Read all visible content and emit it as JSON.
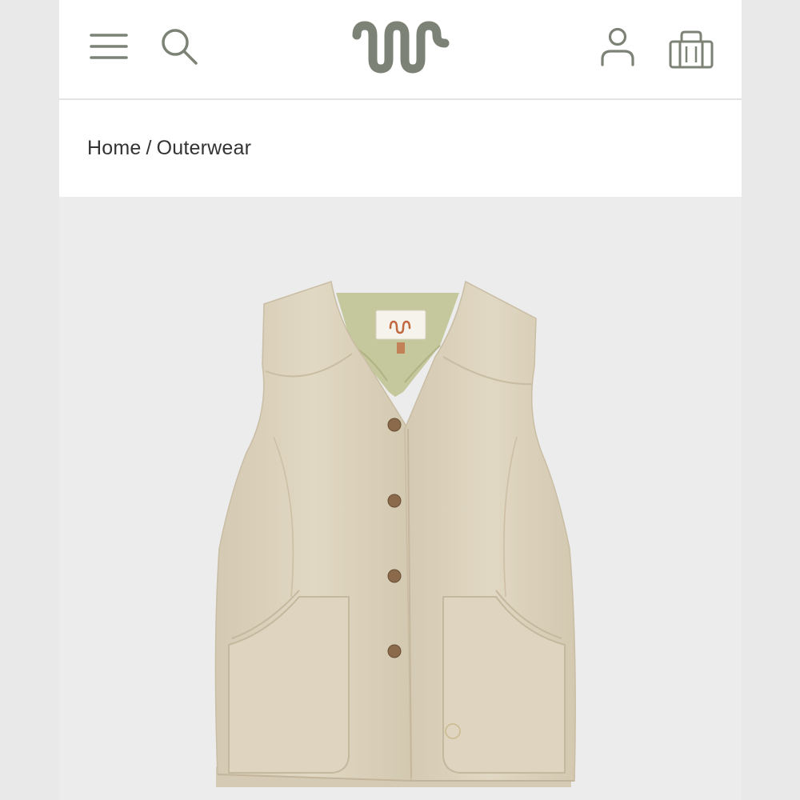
{
  "header": {
    "menu_icon": "hamburger-menu-icon",
    "search_icon": "search-icon",
    "logo_icon": "wavy-w-brand-logo",
    "account_icon": "person-icon",
    "bag_icon": "shopping-bag-icon"
  },
  "breadcrumb": {
    "home_label": "Home",
    "separator": "/",
    "current_label": "Outerwear"
  },
  "colors": {
    "brand": "#7c8275",
    "text": "#333333",
    "vest": "#ddd3be",
    "lining": "#c5c79c",
    "button": "#8a6a4a",
    "label_accent": "#c0693f"
  }
}
